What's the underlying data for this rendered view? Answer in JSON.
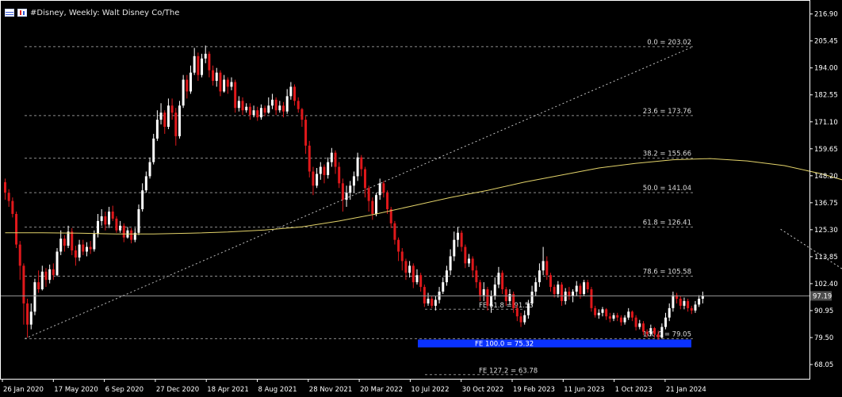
{
  "window": {
    "title": "#Disney, Weekly:  Walt Disney Co/The"
  },
  "colors": {
    "background": "#000000",
    "axis": "#ffffff",
    "grid": "#8c8c8c",
    "bull": "#ffffff",
    "bear": "#e0181b",
    "ma": "#e3d36a",
    "fe_box": "#0a32ff",
    "price_tag_bg": "#4d4d4d"
  },
  "chart_data": {
    "type": "candlestick",
    "ylim": [
      62.0,
      222.5
    ],
    "y_ticks": [
      "216.90",
      "205.45",
      "194.00",
      "182.55",
      "171.10",
      "159.65",
      "148.20",
      "136.75",
      "125.30",
      "113.85",
      "102.40",
      "90.95",
      "79.50",
      "68.05"
    ],
    "x_ticks": [
      "26 Jan 2020",
      "17 May 2020",
      "6 Sep 2020",
      "27 Dec 2020",
      "18 Apr 2021",
      "8 Aug 2021",
      "28 Nov 2021",
      "20 Mar 2022",
      "10 Jul 2022",
      "30 Oct 2022",
      "19 Feb 2023",
      "11 Jun 2023",
      "1 Oct 2023",
      "21 Jan 2024"
    ],
    "current_price": "97.19",
    "fib_retracement": [
      {
        "label": "0.0 = 203.02",
        "value": 203.02
      },
      {
        "label": "23.6 = 173.76",
        "value": 173.76
      },
      {
        "label": "38.2 = 155.66",
        "value": 155.66
      },
      {
        "label": "50.0 = 141.04",
        "value": 141.04
      },
      {
        "label": "61.8 = 126.41",
        "value": 126.41
      },
      {
        "label": "78.6 = 105.58",
        "value": 105.58
      },
      {
        "label": "100.0 = 79.05",
        "value": 79.05
      }
    ],
    "fib_expansion": [
      {
        "label": "FE 61.8 = 91.53",
        "value": 91.53
      },
      {
        "label": "FE 100.0 = 75.32",
        "value": 77.0
      },
      {
        "label": "FE 127.2 = 63.78",
        "value": 63.78
      }
    ],
    "ma_points": [
      [
        0,
        124.0
      ],
      [
        10,
        124.0
      ],
      [
        20,
        123.8
      ],
      [
        30,
        123.5
      ],
      [
        40,
        123.5
      ],
      [
        50,
        123.8
      ],
      [
        60,
        124.3
      ],
      [
        70,
        125.2
      ],
      [
        80,
        126.5
      ],
      [
        90,
        129.0
      ],
      [
        100,
        132.0
      ],
      [
        110,
        135.5
      ],
      [
        120,
        139.0
      ],
      [
        130,
        142.0
      ],
      [
        140,
        145.5
      ],
      [
        150,
        148.5
      ],
      [
        160,
        151.5
      ],
      [
        170,
        153.5
      ],
      [
        180,
        155.0
      ],
      [
        190,
        155.5
      ],
      [
        200,
        154.5
      ],
      [
        210,
        152.5
      ],
      [
        220,
        149.0
      ],
      [
        230,
        144.5
      ],
      [
        240,
        139.5
      ],
      [
        250,
        134.5
      ],
      [
        260,
        129.0
      ],
      [
        270,
        123.5
      ],
      [
        280,
        118.0
      ],
      [
        290,
        113.0
      ],
      [
        300,
        108.5
      ],
      [
        310,
        105.0
      ],
      [
        320,
        102.0
      ],
      [
        330,
        100.0
      ],
      [
        340,
        98.5
      ],
      [
        345,
        97.5
      ]
    ],
    "retracement_line": {
      "from": [
        0,
        79.05
      ],
      "to": [
        345,
        203.02
      ]
    },
    "expansion_lines": [
      [
        [
          209,
          125.5
        ],
        [
          243,
          91.0
        ]
      ],
      [
        [
          243,
          86.5
        ],
        [
          258,
          112.0
        ]
      ],
      [
        [
          258,
          112.0
        ],
        [
          267,
          118.0
        ]
      ]
    ],
    "candles": [
      [
        145.5,
        141.0,
        147.0,
        138.0
      ],
      [
        141.0,
        137.5,
        142.5,
        135.0
      ],
      [
        137.5,
        132.0,
        139.0,
        130.5
      ],
      [
        132.0,
        119.0,
        133.0,
        117.5
      ],
      [
        119.0,
        110.0,
        120.5,
        104.0
      ],
      [
        110.0,
        94.0,
        111.0,
        85.0
      ],
      [
        94.0,
        85.0,
        96.0,
        79.5
      ],
      [
        85.0,
        90.5,
        94.0,
        83.0
      ],
      [
        90.5,
        103.0,
        104.5,
        89.0
      ],
      [
        103.0,
        100.0,
        108.0,
        98.5
      ],
      [
        100.0,
        107.5,
        110.0,
        99.5
      ],
      [
        107.5,
        104.0,
        109.0,
        101.0
      ],
      [
        104.0,
        108.5,
        110.5,
        102.5
      ],
      [
        108.5,
        106.0,
        111.0,
        104.0
      ],
      [
        106.0,
        116.0,
        117.5,
        105.5
      ],
      [
        116.0,
        121.5,
        125.0,
        114.5
      ],
      [
        121.5,
        118.5,
        123.0,
        116.0
      ],
      [
        118.5,
        124.5,
        127.0,
        117.5
      ],
      [
        124.5,
        116.5,
        126.0,
        114.5
      ],
      [
        116.5,
        113.5,
        118.5,
        110.0
      ],
      [
        113.5,
        119.0,
        121.0,
        112.0
      ],
      [
        119.0,
        116.0,
        121.0,
        114.5
      ],
      [
        116.0,
        118.0,
        120.0,
        114.0
      ],
      [
        118.0,
        117.0,
        120.5,
        115.0
      ],
      [
        117.0,
        123.5,
        125.0,
        116.0
      ],
      [
        123.5,
        129.0,
        132.0,
        122.0
      ],
      [
        129.0,
        131.0,
        134.0,
        127.0
      ],
      [
        131.0,
        127.5,
        133.0,
        125.0
      ],
      [
        127.5,
        133.0,
        135.0,
        126.0
      ],
      [
        133.0,
        130.0,
        135.5,
        129.0
      ],
      [
        130.0,
        125.0,
        131.0,
        124.0
      ],
      [
        125.0,
        127.0,
        129.0,
        124.0
      ],
      [
        127.0,
        122.0,
        128.0,
        120.0
      ],
      [
        122.0,
        125.0,
        126.5,
        121.5
      ],
      [
        125.0,
        121.0,
        126.0,
        119.5
      ],
      [
        121.0,
        124.0,
        126.0,
        120.0
      ],
      [
        124.0,
        134.0,
        136.0,
        123.0
      ],
      [
        134.0,
        142.0,
        145.0,
        133.0
      ],
      [
        142.0,
        148.0,
        150.0,
        141.0
      ],
      [
        148.0,
        154.0,
        156.0,
        147.0
      ],
      [
        154.0,
        164.0,
        166.0,
        153.0
      ],
      [
        164.0,
        172.0,
        176.0,
        163.0
      ],
      [
        172.0,
        175.0,
        179.0,
        170.0
      ],
      [
        175.0,
        169.0,
        176.0,
        166.0
      ],
      [
        169.0,
        178.0,
        181.0,
        168.0
      ],
      [
        178.0,
        175.0,
        181.0,
        172.0
      ],
      [
        175.0,
        165.0,
        177.0,
        161.0
      ],
      [
        165.0,
        178.0,
        180.0,
        164.0
      ],
      [
        178.0,
        189.0,
        191.0,
        177.0
      ],
      [
        189.0,
        184.0,
        191.0,
        181.0
      ],
      [
        184.0,
        192.0,
        195.0,
        183.0
      ],
      [
        192.0,
        199.0,
        202.5,
        191.0
      ],
      [
        199.0,
        191.0,
        200.5,
        188.5
      ],
      [
        191.0,
        198.0,
        200.0,
        190.0
      ],
      [
        198.0,
        200.0,
        203.5,
        196.0
      ],
      [
        200.0,
        193.0,
        201.0,
        190.0
      ],
      [
        193.0,
        188.5,
        195.0,
        186.5
      ],
      [
        188.5,
        192.0,
        194.0,
        186.0
      ],
      [
        192.0,
        184.0,
        193.0,
        182.0
      ],
      [
        184.0,
        189.0,
        191.0,
        183.5
      ],
      [
        189.0,
        186.0,
        190.0,
        183.0
      ],
      [
        186.0,
        188.0,
        190.0,
        184.5
      ],
      [
        188.0,
        177.0,
        189.0,
        175.0
      ],
      [
        177.0,
        180.0,
        182.0,
        175.5
      ],
      [
        180.0,
        176.0,
        181.5,
        174.0
      ],
      [
        176.0,
        177.5,
        179.0,
        175.0
      ],
      [
        177.5,
        174.0,
        179.0,
        172.0
      ],
      [
        174.0,
        176.0,
        178.0,
        173.0
      ],
      [
        176.0,
        173.0,
        177.5,
        171.5
      ],
      [
        173.0,
        177.0,
        178.5,
        172.0
      ],
      [
        177.0,
        175.0,
        178.0,
        173.5
      ],
      [
        175.0,
        178.0,
        181.5,
        174.5
      ],
      [
        178.0,
        180.5,
        183.0,
        176.5
      ],
      [
        180.5,
        176.0,
        181.5,
        174.0
      ],
      [
        176.0,
        178.0,
        180.0,
        175.0
      ],
      [
        178.0,
        175.5,
        179.5,
        173.0
      ],
      [
        175.5,
        182.0,
        185.0,
        174.5
      ],
      [
        182.0,
        186.0,
        188.0,
        180.5
      ],
      [
        186.0,
        180.0,
        187.0,
        178.0
      ],
      [
        180.0,
        176.5,
        181.5,
        175.0
      ],
      [
        176.5,
        172.0,
        177.0,
        169.0
      ],
      [
        172.0,
        161.0,
        173.5,
        157.5
      ],
      [
        161.0,
        150.0,
        163.0,
        147.5
      ],
      [
        150.0,
        144.0,
        152.0,
        140.0
      ],
      [
        144.0,
        149.0,
        151.5,
        143.0
      ],
      [
        149.0,
        152.0,
        154.0,
        146.5
      ],
      [
        152.0,
        148.5,
        153.0,
        145.0
      ],
      [
        148.5,
        154.0,
        156.0,
        147.0
      ],
      [
        154.0,
        158.0,
        160.0,
        152.0
      ],
      [
        158.0,
        152.0,
        159.0,
        149.0
      ],
      [
        152.0,
        145.0,
        154.0,
        143.0
      ],
      [
        145.0,
        138.0,
        147.0,
        133.0
      ],
      [
        138.0,
        141.0,
        144.0,
        135.0
      ],
      [
        141.0,
        144.0,
        146.0,
        138.0
      ],
      [
        144.0,
        148.0,
        150.0,
        141.0
      ],
      [
        148.0,
        156.0,
        158.0,
        146.0
      ],
      [
        156.0,
        151.0,
        157.0,
        148.0
      ],
      [
        151.0,
        143.0,
        152.0,
        139.0
      ],
      [
        143.0,
        137.5,
        144.0,
        133.0
      ],
      [
        137.5,
        132.0,
        139.0,
        129.5
      ],
      [
        132.0,
        140.0,
        141.0,
        131.0
      ],
      [
        140.0,
        145.0,
        147.0,
        138.0
      ],
      [
        145.0,
        141.0,
        146.0,
        139.0
      ],
      [
        141.0,
        134.0,
        142.0,
        132.0
      ],
      [
        134.0,
        128.0,
        135.0,
        126.0
      ],
      [
        128.0,
        121.0,
        129.0,
        119.0
      ],
      [
        121.0,
        116.0,
        122.0,
        112.0
      ],
      [
        116.0,
        112.0,
        117.5,
        108.0
      ],
      [
        112.0,
        107.0,
        113.0,
        104.0
      ],
      [
        107.0,
        110.0,
        112.0,
        105.0
      ],
      [
        110.0,
        103.0,
        111.0,
        100.5
      ],
      [
        103.0,
        106.0,
        108.5,
        102.0
      ],
      [
        106.0,
        101.0,
        107.0,
        99.0
      ],
      [
        101.0,
        94.0,
        102.0,
        92.5
      ],
      [
        94.0,
        96.0,
        98.5,
        93.0
      ],
      [
        96.0,
        93.0,
        97.0,
        92.0
      ],
      [
        93.0,
        95.5,
        97.0,
        91.0
      ],
      [
        95.5,
        99.0,
        101.0,
        94.0
      ],
      [
        99.0,
        103.0,
        105.0,
        98.0
      ],
      [
        103.0,
        108.0,
        110.0,
        101.5
      ],
      [
        108.0,
        114.0,
        117.0,
        106.0
      ],
      [
        114.0,
        121.0,
        124.5,
        112.0
      ],
      [
        121.0,
        124.0,
        126.5,
        118.0
      ],
      [
        124.0,
        118.0,
        125.0,
        116.0
      ],
      [
        118.0,
        111.0,
        119.0,
        109.0
      ],
      [
        111.0,
        113.0,
        115.0,
        109.5
      ],
      [
        113.0,
        108.0,
        114.0,
        105.0
      ],
      [
        108.0,
        103.0,
        110.0,
        100.5
      ],
      [
        103.0,
        97.5,
        104.0,
        95.0
      ],
      [
        97.5,
        100.0,
        103.0,
        95.0
      ],
      [
        100.0,
        93.0,
        101.0,
        91.0
      ],
      [
        93.0,
        97.0,
        99.5,
        90.0
      ],
      [
        97.0,
        102.0,
        105.0,
        95.5
      ],
      [
        102.0,
        107.0,
        109.5,
        100.5
      ],
      [
        107.0,
        100.0,
        108.0,
        98.0
      ],
      [
        100.0,
        95.0,
        101.0,
        93.0
      ],
      [
        95.0,
        98.0,
        100.0,
        93.5
      ],
      [
        98.0,
        92.0,
        99.0,
        90.0
      ],
      [
        92.0,
        88.5,
        93.5,
        86.5
      ],
      [
        88.5,
        86.0,
        90.0,
        84.0
      ],
      [
        86.0,
        89.0,
        91.0,
        85.0
      ],
      [
        89.0,
        94.0,
        95.5,
        87.5
      ],
      [
        94.0,
        99.0,
        101.5,
        93.0
      ],
      [
        99.0,
        103.0,
        105.0,
        97.0
      ],
      [
        103.0,
        108.0,
        111.0,
        101.0
      ],
      [
        108.0,
        112.0,
        118.0,
        106.0
      ],
      [
        112.0,
        106.0,
        114.0,
        104.0
      ],
      [
        106.0,
        101.0,
        107.0,
        99.0
      ],
      [
        101.0,
        98.0,
        102.0,
        96.5
      ],
      [
        98.0,
        102.0,
        103.5,
        96.5
      ],
      [
        102.0,
        95.0,
        103.0,
        93.0
      ],
      [
        95.0,
        99.0,
        100.5,
        93.5
      ],
      [
        99.0,
        97.0,
        101.0,
        95.5
      ],
      [
        97.0,
        99.0,
        100.0,
        94.5
      ],
      [
        99.0,
        101.5,
        103.5,
        97.0
      ],
      [
        101.5,
        98.0,
        102.5,
        96.0
      ],
      [
        98.0,
        103.0,
        104.0,
        97.0
      ],
      [
        103.0,
        100.0,
        104.0,
        98.5
      ],
      [
        100.0,
        92.0,
        101.0,
        90.5
      ],
      [
        92.0,
        89.0,
        93.0,
        88.0
      ],
      [
        89.0,
        90.0,
        91.5,
        87.5
      ],
      [
        90.0,
        91.5,
        92.5,
        88.5
      ],
      [
        91.5,
        88.5,
        92.0,
        87.0
      ],
      [
        88.5,
        87.5,
        90.0,
        86.0
      ],
      [
        87.5,
        89.0,
        90.0,
        86.5
      ],
      [
        89.0,
        88.0,
        90.0,
        86.5
      ],
      [
        88.0,
        86.0,
        89.0,
        84.5
      ],
      [
        86.0,
        88.0,
        89.0,
        85.0
      ],
      [
        88.0,
        90.5,
        92.0,
        87.0
      ],
      [
        90.5,
        88.0,
        91.0,
        86.5
      ],
      [
        88.0,
        84.0,
        89.0,
        82.5
      ],
      [
        84.0,
        85.5,
        87.0,
        83.0
      ],
      [
        85.5,
        82.0,
        86.5,
        80.5
      ],
      [
        82.0,
        81.0,
        83.0,
        79.5
      ],
      [
        81.0,
        83.5,
        85.0,
        80.0
      ],
      [
        83.5,
        81.0,
        84.0,
        79.5
      ],
      [
        81.0,
        79.5,
        82.5,
        78.5
      ],
      [
        79.5,
        84.0,
        85.5,
        79.0
      ],
      [
        84.0,
        88.0,
        90.0,
        83.0
      ],
      [
        88.0,
        92.0,
        94.0,
        86.5
      ],
      [
        92.0,
        97.5,
        99.0,
        90.5
      ],
      [
        97.5,
        96.0,
        98.5,
        94.0
      ],
      [
        96.0,
        93.0,
        97.0,
        91.5
      ],
      [
        93.0,
        95.0,
        96.5,
        91.5
      ],
      [
        95.0,
        92.0,
        96.0,
        90.5
      ],
      [
        92.0,
        91.0,
        93.0,
        89.5
      ],
      [
        91.0,
        93.5,
        95.0,
        90.0
      ],
      [
        93.5,
        96.0,
        97.5,
        92.5
      ],
      [
        96.0,
        97.19,
        99.0,
        94.0
      ]
    ]
  }
}
